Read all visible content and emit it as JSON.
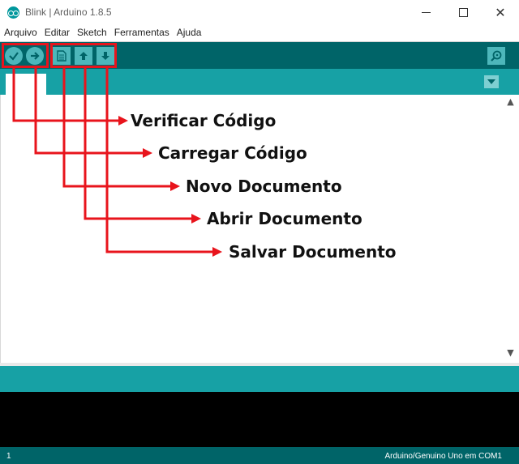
{
  "window": {
    "title": "Blink | Arduino 1.8.5",
    "icon": "arduino-logo-icon"
  },
  "menu": [
    {
      "label": "Arquivo"
    },
    {
      "label": "Editar"
    },
    {
      "label": "Sketch"
    },
    {
      "label": "Ferramentas"
    },
    {
      "label": "Ajuda"
    }
  ],
  "toolbar": {
    "buttons": [
      "verify-icon",
      "upload-icon",
      "new-file-icon",
      "open-file-icon",
      "save-file-icon"
    ],
    "monitor_icon": "serial-monitor-icon"
  },
  "annotations": {
    "verify": "Verificar Código",
    "upload": "Carregar Código",
    "new": "Novo Documento",
    "open": "Abrir Documento",
    "save": "Salvar Documento"
  },
  "statusbar": {
    "line": "1",
    "board": "Arduino/Genuino Uno em COM1"
  },
  "colors": {
    "toolbar": "#006468",
    "tabstrip": "#17a1a5",
    "button": "#4db7bb",
    "annotation_red": "#e8141c",
    "console": "#000000"
  }
}
